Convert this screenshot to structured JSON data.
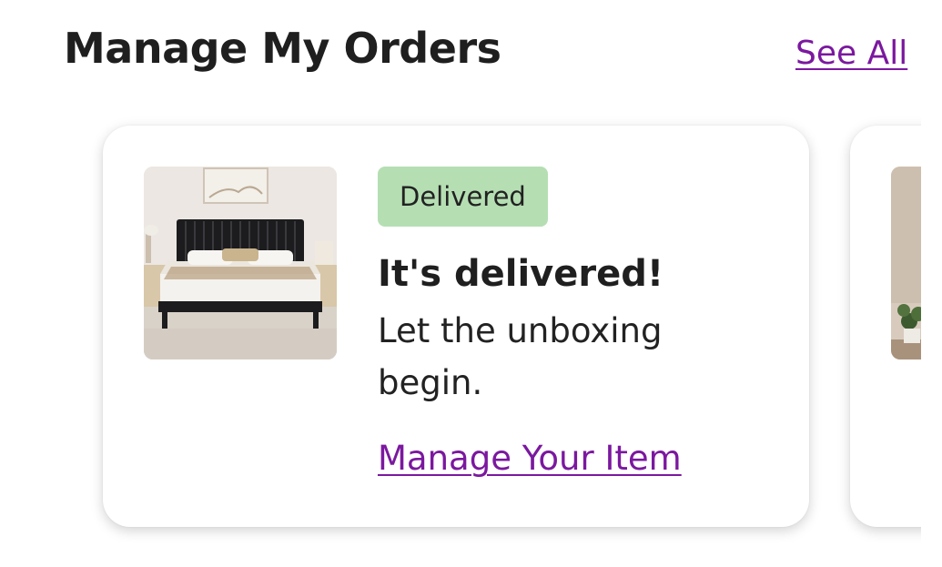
{
  "header": {
    "title": "Manage My Orders",
    "see_all_label": "See All"
  },
  "orders": [
    {
      "status_badge": "Delivered",
      "heading": "It's delivered!",
      "message": "Let the unboxing begin.",
      "action_label": "Manage Your Item",
      "image": "bed-product-image"
    },
    {
      "image": "plant-room-product-image"
    }
  ],
  "colors": {
    "link": "#7b189f",
    "badge_background": "#b5dfb3",
    "text": "#1f1f1f"
  }
}
